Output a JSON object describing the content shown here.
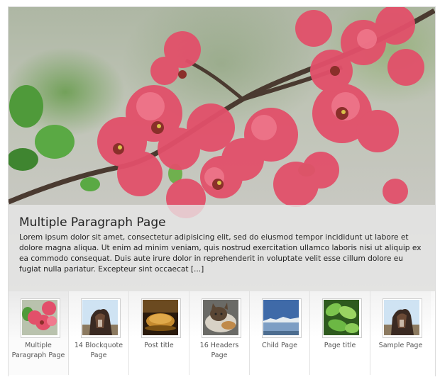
{
  "featured": {
    "title": "Multiple Paragraph Page",
    "excerpt": "Lorem ipsum dolor sit amet, consectetur adipisicing elit, sed do eiusmod tempor incididunt ut labore et dolore magna aliqua. Ut enim ad minim veniam, quis nostrud exercitation ullamco laboris nisi ut aliquip ex ea commodo consequat. Duis aute irure dolor in reprehenderit in voluptate velit esse cillum dolore eu fugiat nulla pariatur. Excepteur sint occaecat [...]"
  },
  "thumbnails": [
    {
      "label": "Multiple Paragraph Page",
      "image": "pink-blossom-photo",
      "active": true
    },
    {
      "label": "14 Blockquote Page",
      "image": "horse-photo",
      "active": false
    },
    {
      "label": "Post title",
      "image": "bread-loaf-photo",
      "active": false
    },
    {
      "label": "16 Headers Page",
      "image": "cat-photo",
      "active": false
    },
    {
      "label": "Child Page",
      "image": "mountain-lake-photo",
      "active": false
    },
    {
      "label": "Page title",
      "image": "green-leaves-photo",
      "active": false
    },
    {
      "label": "Sample Page",
      "image": "horse-photo",
      "active": false
    }
  ],
  "colors": {
    "caption_overlay": "#e8e8e8",
    "blossom": "#e2506a",
    "text": "#222222",
    "thumb_label": "#555555"
  }
}
